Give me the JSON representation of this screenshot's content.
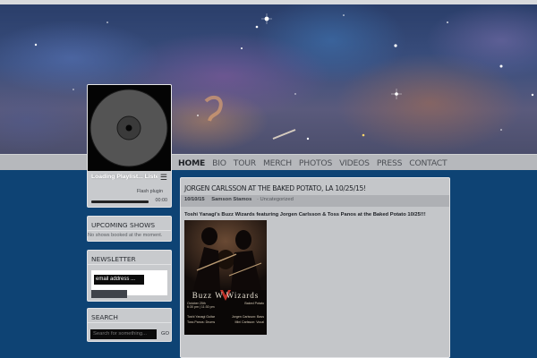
{
  "nav": {
    "items": [
      "HOME",
      "BIO",
      "TOUR",
      "MERCH",
      "PHOTOS",
      "VIDEOS",
      "PRESS",
      "CONTACT"
    ],
    "active": "HOME"
  },
  "player": {
    "title": "Loading Playlist... Listening? Nothing Queued To Play",
    "flash_notice": "Flash plugin",
    "time": "00:00",
    "progress": 0
  },
  "sidebar": {
    "shows": {
      "title": "UPCOMING SHOWS",
      "empty": "No shows booked at the moment."
    },
    "newsletter": {
      "title": "NEWSLETTER",
      "placeholder": "email address ..."
    },
    "search": {
      "title": "SEARCH",
      "placeholder": "Search for something...",
      "go": "GO"
    }
  },
  "post": {
    "title": "JORGEN CARLSSON AT THE BAKED POTATO, LA 10/25/15!",
    "date": "10/10/15",
    "author": "Samson Stamos",
    "category": "· Uncategorized",
    "body": "Toshi Yanagi's Buzz Wizards featuring Jorgen Carlsson & Toss Panos at the Baked Potato 10/25!!!"
  },
  "poster": {
    "logo": "Buzz W Wizards",
    "date_line": "October 25th",
    "time_line": "6:30 pm | 11:30 pm",
    "venue": "Baked Potato",
    "lineup": [
      [
        "Toshi Yanagi Guitar",
        "Jorgen Carlsson: Bass"
      ],
      [
        "Toss Panos: Drums",
        "Mini Carlsson: Vocal"
      ]
    ]
  },
  "colors": {
    "background": "#0e4374",
    "panel": "#c8cacd",
    "nav": "#b6b8bc"
  }
}
